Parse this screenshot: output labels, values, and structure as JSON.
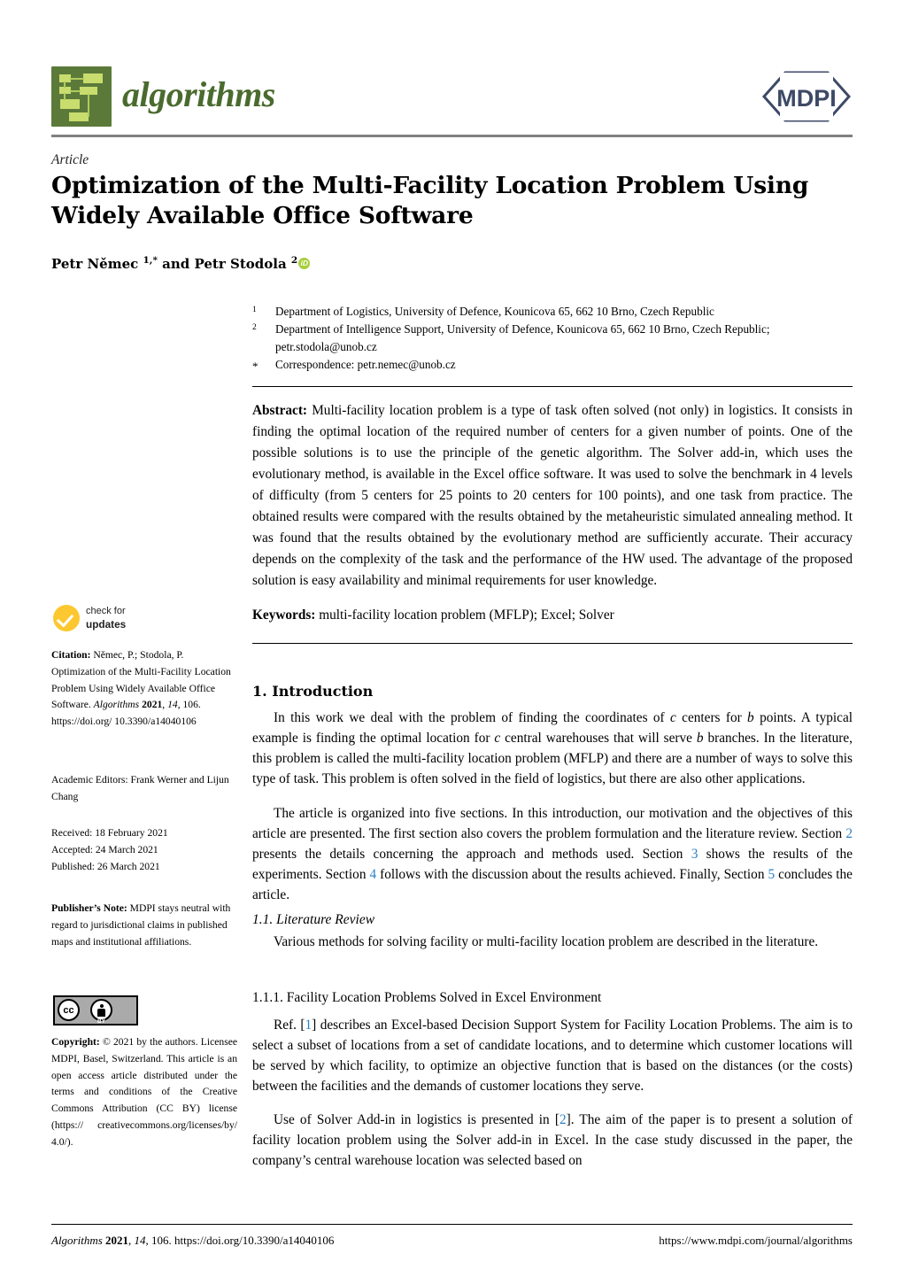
{
  "header": {
    "journal_name": "algorithms",
    "publisher_logo_text": "MDPI",
    "logo_icon": "algorithms-flowchart-icon"
  },
  "title_block": {
    "kicker": "Article",
    "title_line1": "Optimization of the Multi-Facility Location Problem Using",
    "title_line2": "Widely Available Office Software",
    "authors_prefix": "Petr Němec ",
    "author1_marks": "1,*",
    "authors_mid": " and Petr Stodola ",
    "author2_marks": "2",
    "orcid_label": "iD"
  },
  "affiliations": [
    {
      "mark": "1",
      "text": "Department of Logistics, University of Defence, Kounicova 65, 662 10 Brno, Czech Republic"
    },
    {
      "mark": "2",
      "text": "Department of Intelligence Support, University of Defence, Kounicova 65, 662 10 Brno, Czech Republic; petr.stodola@unob.cz"
    },
    {
      "mark": "*",
      "text": "Correspondence: petr.nemec@unob.cz"
    }
  ],
  "abstract": {
    "label": "Abstract:",
    "text": " Multi-facility location problem is a type of task often solved (not only) in logistics. It consists in finding the optimal location of the required number of centers for a given number of points. One of the possible solutions is to use the principle of the genetic algorithm. The Solver add-in, which uses the evolutionary method, is available in the Excel office software. It was used to solve the benchmark in 4 levels of difficulty (from 5 centers for 25 points to 20 centers for 100 points), and one task from practice. The obtained results were compared with the results obtained by the metaheuristic simulated annealing method. It was found that the results obtained by the evolutionary method are sufficiently accurate. Their accuracy depends on the complexity of the task and the performance of the HW used. The advantage of the proposed solution is easy availability and minimal requirements for user knowledge."
  },
  "keywords": {
    "label": "Keywords:",
    "text": " multi-facility location problem (MFLP); Excel; Solver"
  },
  "sidebar": {
    "check_updates_line1": "check for",
    "check_updates_line2": "updates",
    "citation_label": "Citation:",
    "citation_text_1": " Němec, P.; Stodola, P. Optimization of the Multi-Facility Location Problem Using Widely Available Office Software. ",
    "citation_journal": "Algorithms",
    "citation_year": "2021",
    "citation_volume": "14",
    "citation_rest": ", 106. https://doi.org/ 10.3390/a14040106",
    "academic_editors": "Academic Editors: Frank Werner and Lijun Chang",
    "received": "Received: 18 February 2021",
    "accepted": "Accepted: 24 March 2021",
    "published": "Published: 26 March 2021",
    "publisher_note_label": "Publisher’s Note:",
    "publisher_note_text": " MDPI stays neutral with regard to jurisdictional claims in published maps and institutional affiliations.",
    "copyright_label": "Copyright:",
    "copyright_text": " © 2021 by the authors. Licensee MDPI, Basel, Switzerland. This article is an open access article distributed under the terms and conditions of the Creative Commons Attribution (CC BY) license (https:// creativecommons.org/licenses/by/ 4.0/).",
    "cc_mark": "cc",
    "cc_by": "BY"
  },
  "main": {
    "sec1_heading": "1. Introduction",
    "p1_a": "In this work we deal with the problem of finding the coordinates of ",
    "p1_var_c1": "c",
    "p1_b": " centers for ",
    "p1_var_b1": "b",
    "p1_c": " points. A typical example is finding the optimal location for ",
    "p1_var_c2": "c",
    "p1_d": " central warehouses that will serve ",
    "p1_var_b2": "b",
    "p1_e": " branches. In the literature, this problem is called the multi-facility location problem (MFLP) and there are a number of ways to solve this type of task. This problem is often solved in the field of logistics, but there are also other applications.",
    "p2_a": "The article is organized into five sections. In this introduction, our motivation and the objectives of this article are presented. The first section also covers the problem formulation and the literature review. Section ",
    "p2_ref2": "2",
    "p2_b": " presents the details concerning the approach and methods used. Section ",
    "p2_ref3": "3",
    "p2_c": " shows the results of the experiments. Section ",
    "p2_ref4": "4",
    "p2_d": " follows with the discussion about the results achieved. Finally, Section ",
    "p2_ref5": "5",
    "p2_e": " concludes the article.",
    "sec11_heading": "1.1. Literature Review",
    "p3": "Various methods for solving facility or multi-facility location problem are described in the literature.",
    "sec111_heading": "1.1.1. Facility Location Problems Solved in Excel Environment",
    "p4_a": "Ref. [",
    "p4_ref1": "1",
    "p4_b": "] describes an Excel-based Decision Support System for Facility Location Problems. The aim is to select a subset of locations from a set of candidate locations, and to determine which customer locations will be served by which facility, to optimize an objective function that is based on the distances (or the costs) between the facilities and the demands of customer locations they serve.",
    "p5_a": "Use of Solver Add-in in logistics is presented in [",
    "p5_ref2": "2",
    "p5_b": "]. The aim of the paper is to present a solution of facility location problem using the Solver add-in in Excel. In the case study discussed in the paper, the company’s central warehouse location was selected based on"
  },
  "footer": {
    "left_journal": "Algorithms",
    "left_year": "2021",
    "left_vol": "14",
    "left_rest": ", 106. https://doi.org/10.3390/a14040106",
    "right": "https://www.mdpi.com/journal/algorithms"
  },
  "colors": {
    "journal_green": "#4a6b2e",
    "logo_bg": "#5b7a3a",
    "logo_box": "#c9dd6f",
    "mdpi_navy": "#3d4a66",
    "link_blue": "#2b7fc4",
    "orcid_green": "#a6ce39",
    "check_yellow": "#fdc82f",
    "rule_gray": "#808080"
  }
}
